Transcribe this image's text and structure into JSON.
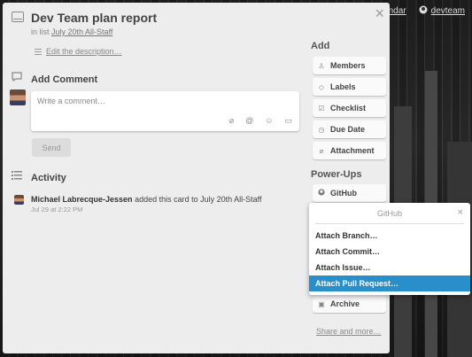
{
  "topbar": {
    "calendar_label": "Calendar",
    "github_user": "devteam"
  },
  "card": {
    "title": "Dev Team plan report",
    "in_list_prefix": "in list",
    "list_name": "July 20th All-Staff",
    "edit_description": "Edit the description…"
  },
  "comment": {
    "section_title": "Add Comment",
    "placeholder": "Write a comment…",
    "send_label": "Send"
  },
  "activity": {
    "section_title": "Activity",
    "entries": [
      {
        "user": "Michael Labrecque-Jessen",
        "action": "added this card to July 20th All-Staff",
        "time": "Jul 29 at 2:22 PM"
      }
    ]
  },
  "sidebar": {
    "add_title": "Add",
    "add_buttons": [
      {
        "label": "Members",
        "icon": "person-icon"
      },
      {
        "label": "Labels",
        "icon": "tag-icon"
      },
      {
        "label": "Checklist",
        "icon": "checkbox-icon"
      },
      {
        "label": "Due Date",
        "icon": "clock-icon"
      },
      {
        "label": "Attachment",
        "icon": "paperclip-icon"
      }
    ],
    "powerups_title": "Power-Ups",
    "github_label": "GitHub",
    "archive_label": "Archive",
    "share_label": "Share and more…"
  },
  "github_popover": {
    "title": "GitHub",
    "items": [
      "Attach Branch…",
      "Attach Commit…",
      "Attach Issue…",
      "Attach Pull Request…"
    ],
    "active_index": 3
  },
  "colors": {
    "accent": "#298fca",
    "card_bg": "#ededed"
  }
}
